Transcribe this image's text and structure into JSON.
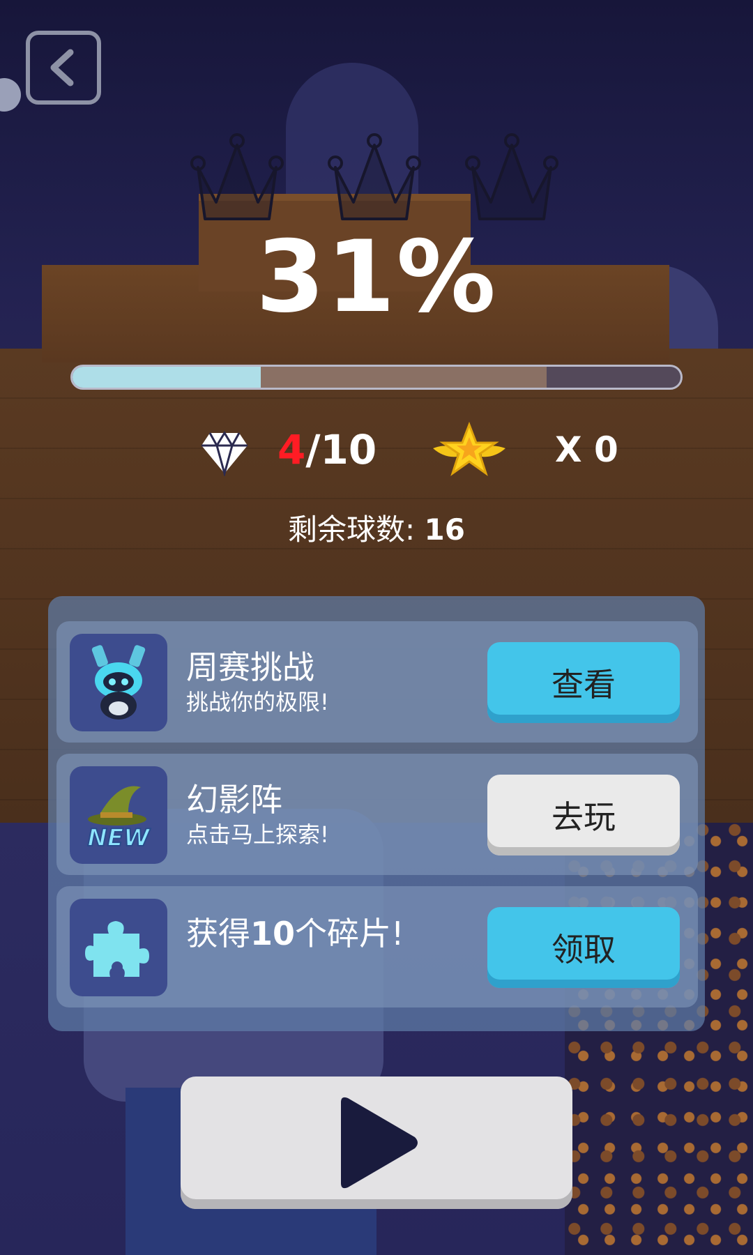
{
  "score": {
    "percent_text": "31%",
    "progress": 0.31,
    "progress_best": 0.78
  },
  "crowns": {
    "earned": 0,
    "total": 3,
    "icon": "crown-icon"
  },
  "gems": {
    "collected": "4",
    "separator_total": "/10",
    "icon": "diamond-icon"
  },
  "stars": {
    "count_text": "X 0",
    "icon": "winged-star-icon"
  },
  "balls": {
    "label": "剩余球数: ",
    "count": "16"
  },
  "missions": [
    {
      "title": "周赛挑战",
      "subtitle": "挑战你的极限!",
      "button": "查看",
      "button_style": "blue",
      "icon": "robot-character-icon"
    },
    {
      "title": "幻影阵",
      "subtitle": "点击马上探索!",
      "button": "去玩",
      "button_style": "white",
      "icon": "wizard-hat-new-icon",
      "badge": "NEW"
    },
    {
      "title_prefix": "获得",
      "title_num": "10",
      "title_suffix": "个碎片!",
      "button": "领取",
      "button_style": "blue",
      "icon": "puzzle-piece-icon"
    }
  ],
  "nav": {
    "back_icon": "back-arrow-icon",
    "play_icon": "play-icon"
  },
  "colors": {
    "accent_blue": "#43c5ea",
    "gem_red": "#ff1c24",
    "progress_fill": "#aedee8"
  }
}
